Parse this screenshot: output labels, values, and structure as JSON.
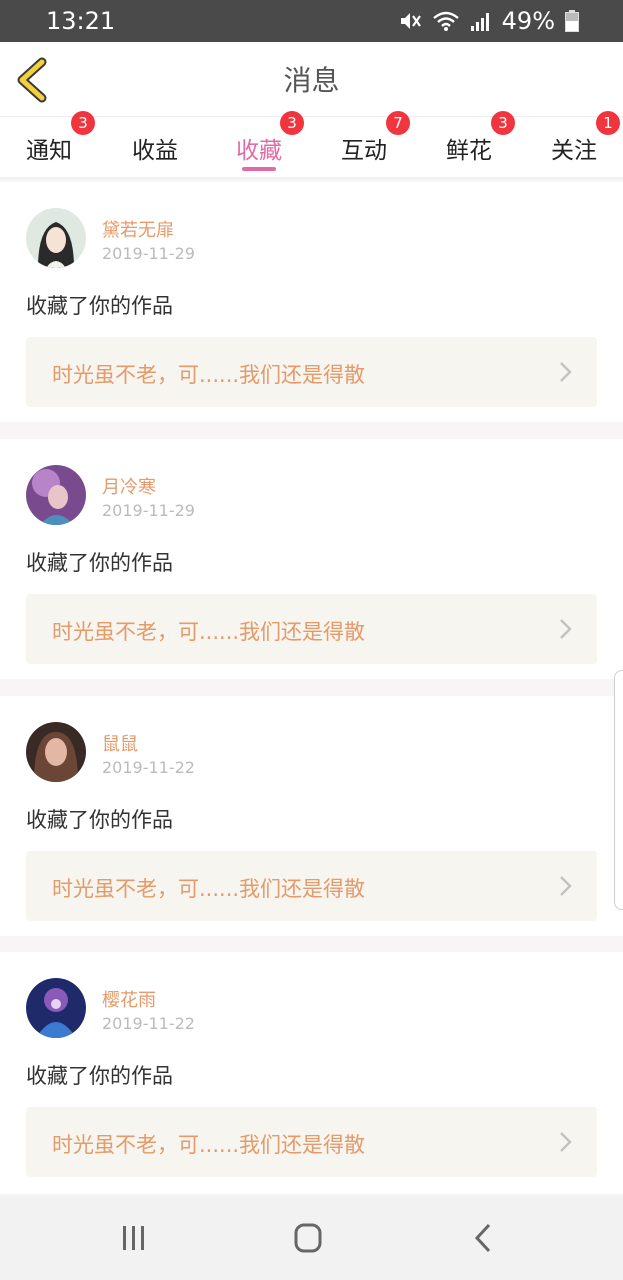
{
  "status_bar": {
    "time": "13:21",
    "battery": "49%",
    "icons": [
      "mute-icon",
      "wifi-icon",
      "signal-icon",
      "battery-icon"
    ]
  },
  "header": {
    "title": "消息",
    "back_icon": "chevron-left-icon"
  },
  "tabs": [
    {
      "label": "通知",
      "badge": "3",
      "active": false
    },
    {
      "label": "收益",
      "badge": "",
      "active": false
    },
    {
      "label": "收藏",
      "badge": "3",
      "active": true
    },
    {
      "label": "互动",
      "badge": "7",
      "active": false
    },
    {
      "label": "鲜花",
      "badge": "3",
      "active": false
    },
    {
      "label": "关注",
      "badge": "1",
      "active": false
    }
  ],
  "messages": [
    {
      "user": "黛若无扉",
      "date": "2019-11-29",
      "action": "收藏了你的作品",
      "work": "时光虽不老，可......我们还是得散"
    },
    {
      "user": "月冷寒",
      "date": "2019-11-29",
      "action": "收藏了你的作品",
      "work": "时光虽不老，可......我们还是得散"
    },
    {
      "user": "鼠鼠",
      "date": "2019-11-22",
      "action": "收藏了你的作品",
      "work": "时光虽不老，可......我们还是得散"
    },
    {
      "user": "樱花雨",
      "date": "2019-11-22",
      "action": "收藏了你的作品",
      "work": "时光虽不老，可......我们还是得散"
    }
  ],
  "colors": {
    "accent": "#e36aa6",
    "badge": "#f0353f",
    "name": "#e59a6a",
    "back_icon": "#f2d23c"
  },
  "nav": {
    "icons": [
      "recent-apps-icon",
      "home-icon",
      "back-icon"
    ]
  }
}
